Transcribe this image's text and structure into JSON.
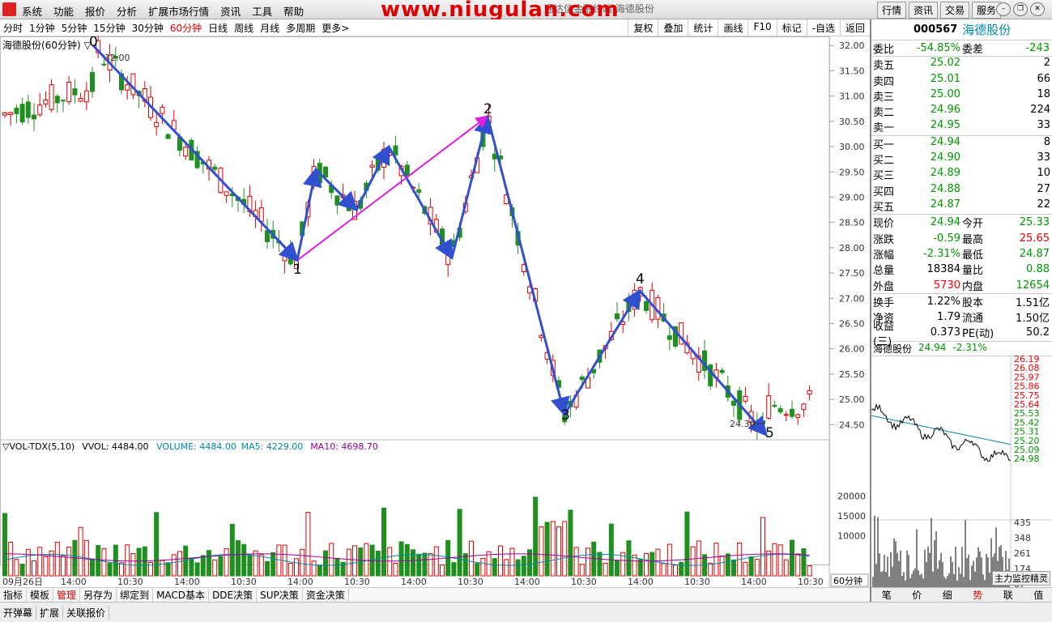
{
  "menubar": {
    "items": [
      "系统",
      "功能",
      "报价",
      "分析",
      "扩展市场行情",
      "资讯",
      "工具",
      "帮助"
    ],
    "watermark": "www.niugulan.com",
    "subtitle": "通达信金融终端 海德股份",
    "right_buttons": [
      "行情",
      "资讯",
      "交易",
      "服务"
    ]
  },
  "toolbar": {
    "periods": [
      "分时",
      "1分钟",
      "5分钟",
      "15分钟",
      "30分钟",
      "60分钟",
      "日线",
      "周线",
      "月线",
      "多周期",
      "更多>"
    ],
    "active": "60分钟",
    "right": [
      "复权",
      "叠加",
      "统计",
      "画线",
      "F10",
      "标记",
      "-自选",
      "返回"
    ]
  },
  "chart": {
    "title": "海德股份(60分钟) ▽",
    "price_axis": [
      "32.00",
      "31.50",
      "31.00",
      "30.50",
      "30.00",
      "29.50",
      "29.00",
      "28.50",
      "28.00",
      "27.50",
      "27.00",
      "26.50",
      "26.00",
      "25.50",
      "25.00",
      "24.50"
    ],
    "high_label": "32.00",
    "low_label": "24.30",
    "wave_labels": [
      "0",
      "1",
      "2",
      "3",
      "4",
      "5"
    ],
    "volume_header": {
      "name": "▽VOL-TDX(5,10)",
      "vvol": "VVOL: 4484.00",
      "volume": "VOLUME: 4484.00",
      "ma5": "MA5: 4229.00",
      "ma10": "MA10: 4698.70"
    },
    "volume_axis": [
      "20000",
      "15000",
      "10000"
    ],
    "time_axis": [
      "09月26日",
      "14:00",
      "10:30",
      "14:00",
      "10:30",
      "14:00",
      "10:30",
      "14:00",
      "10:30",
      "14:00",
      "10:30",
      "14:00",
      "10:30",
      "14:00",
      "10:30"
    ],
    "period_badge": "60分钟"
  },
  "bottom_tabs": [
    "指标",
    "模板",
    "管理",
    "另存为",
    "绑定到",
    "MACD基本",
    "DDE决策",
    "SUP决策",
    "资金决策"
  ],
  "bottom_tabs_active": "管理",
  "status_tabs": [
    "开弹幕",
    "扩展",
    "关联报价"
  ],
  "side": {
    "code": "000567",
    "name": "海德股份",
    "weibi": {
      "k": "委比",
      "v": "-54.85%",
      "k2": "委差",
      "v2": "-243"
    },
    "sells": [
      {
        "k": "卖五",
        "p": "25.02",
        "q": "2"
      },
      {
        "k": "卖四",
        "p": "25.01",
        "q": "66"
      },
      {
        "k": "卖三",
        "p": "25.00",
        "q": "18"
      },
      {
        "k": "卖二",
        "p": "24.96",
        "q": "224"
      },
      {
        "k": "卖一",
        "p": "24.95",
        "q": "33"
      }
    ],
    "buys": [
      {
        "k": "买一",
        "p": "24.94",
        "q": "8"
      },
      {
        "k": "买二",
        "p": "24.90",
        "q": "33"
      },
      {
        "k": "买三",
        "p": "24.89",
        "q": "10"
      },
      {
        "k": "买四",
        "p": "24.88",
        "q": "27"
      },
      {
        "k": "买五",
        "p": "24.87",
        "q": "22"
      }
    ],
    "quote": [
      {
        "k": "现价",
        "v": "24.94",
        "c": "grn",
        "k2": "今开",
        "v2": "25.33",
        "c2": "grn"
      },
      {
        "k": "涨跌",
        "v": "-0.59",
        "c": "grn",
        "k2": "最高",
        "v2": "25.65",
        "c2": "red"
      },
      {
        "k": "涨幅",
        "v": "-2.31%",
        "c": "grn",
        "k2": "最低",
        "v2": "24.87",
        "c2": "grn"
      },
      {
        "k": "总量",
        "v": "18384",
        "c": "",
        "k2": "量比",
        "v2": "0.88",
        "c2": "grn"
      },
      {
        "k": "外盘",
        "v": "5730",
        "c": "red",
        "k2": "内盘",
        "v2": "12654",
        "c2": "grn"
      }
    ],
    "finance": [
      {
        "k": "换手",
        "v": "1.22%",
        "k2": "股本",
        "v2": "1.51亿"
      },
      {
        "k": "净资",
        "v": "1.79",
        "k2": "流通",
        "v2": "1.50亿"
      },
      {
        "k": "收益(三)",
        "v": "0.373",
        "k2": "PE(动)",
        "v2": "50.2"
      }
    ],
    "mini": {
      "name": "海德股份",
      "price": "24.94",
      "pct": "-2.31%",
      "axis": [
        "26.19",
        "26.08",
        "25.97",
        "25.86",
        "25.75",
        "25.64",
        "25.53",
        "25.42",
        "25.31",
        "25.20",
        "25.09",
        "24.98"
      ],
      "vol_axis": [
        "435",
        "348",
        "261",
        "174",
        "87"
      ]
    },
    "tip": "主力监控精灵",
    "bottom": [
      "笔",
      "价",
      "细",
      "势",
      "联",
      "值"
    ],
    "bottom_active": "势"
  },
  "colors": {
    "up": "#e00000",
    "down": "#1f8f1f",
    "wave": "#3050d0",
    "magenta": "#e020e0"
  }
}
